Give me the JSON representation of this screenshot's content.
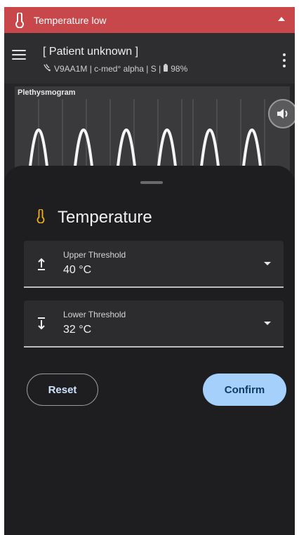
{
  "alert": {
    "title": "Temperature low",
    "icon": "thermometer-icon",
    "color": "#c8474a"
  },
  "header": {
    "patient": "[ Patient unknown ]",
    "device_icon": "sensor-icon",
    "device_line": "V9AA1M | c-med° alpha | S |",
    "battery_icon": "battery-icon",
    "battery": "98%"
  },
  "pleth": {
    "label": "Plethysmogram",
    "sound_icon": "volume-icon"
  },
  "sheet": {
    "title": "Temperature",
    "title_icon": "thermometer-icon",
    "accent": "#f2b01e",
    "upper": {
      "label": "Upper Threshold",
      "value": "40 °C",
      "icon": "arrow-up-bar-icon"
    },
    "lower": {
      "label": "Lower Threshold",
      "value": "32 °C",
      "icon": "arrow-down-bar-icon"
    },
    "reset_label": "Reset",
    "confirm_label": "Confirm",
    "confirm_color": "#a4d0fb"
  }
}
